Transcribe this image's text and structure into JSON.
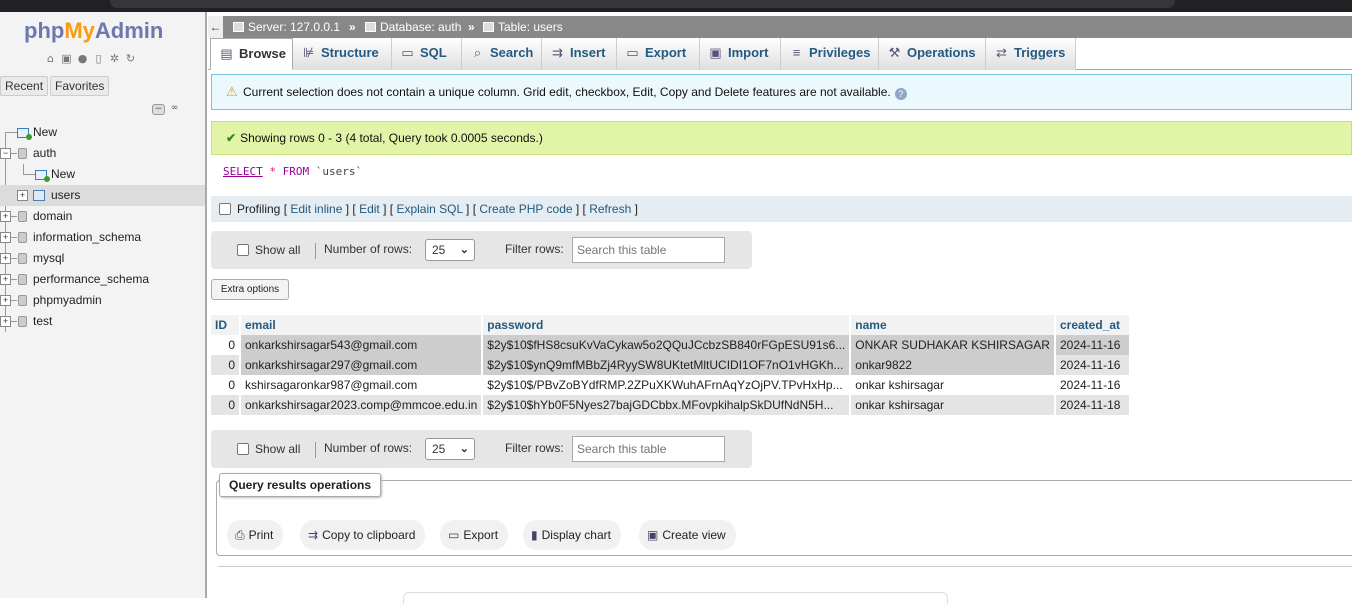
{
  "logo": {
    "part1": "php",
    "part2": "My",
    "part3": "Admin"
  },
  "left_tabs": {
    "recent": "Recent",
    "favorites": "Favorites"
  },
  "tree": {
    "new_root": "New",
    "auth": "auth",
    "auth_new": "New",
    "users": "users",
    "dbs": [
      "domain",
      "information_schema",
      "mysql",
      "performance_schema",
      "phpmyadmin",
      "test"
    ]
  },
  "breadcrumb": {
    "server": "Server: 127.0.0.1",
    "database": "Database: auth",
    "table": "Table: users",
    "sep": "»"
  },
  "tabs": [
    "Browse",
    "Structure",
    "SQL",
    "Search",
    "Insert",
    "Export",
    "Import",
    "Privileges",
    "Operations",
    "Triggers"
  ],
  "notice": "Current selection does not contain a unique column. Grid edit, checkbox, Edit, Copy and Delete features are not available.",
  "success": "Showing rows 0 - 3 (4 total, Query took 0.0005 seconds.)",
  "sql": {
    "select": "SELECT",
    "star": "*",
    "from": "FROM",
    "table": "`users`"
  },
  "profiling": {
    "label": "Profiling",
    "links": [
      "Edit inline",
      "Edit",
      "Explain SQL",
      "Create PHP code",
      "Refresh"
    ]
  },
  "nav": {
    "show_all": "Show all",
    "num_rows_label": "Number of rows:",
    "num_rows_value": "25",
    "filter_label": "Filter rows:",
    "filter_placeholder": "Search this table"
  },
  "extra_options": "Extra options",
  "table": {
    "columns": [
      "ID",
      "email",
      "password",
      "name",
      "created_at"
    ],
    "rows": [
      [
        "0",
        "onkarkshirsagar543@gmail.com",
        "$2y$10$fHS8csuKvVaCykaw5o2QQuJCcbzSB840rFGpESU91s6...",
        "ONKAR SUDHAKAR KSHIRSAGAR",
        "2024-11-16"
      ],
      [
        "0",
        "onkarkshirsagar297@gmail.com",
        "$2y$10$ynQ9mfMBbZj4RyySW8UKtetMltUCIDI1OF7nO1vHGKh...",
        "onkar9822",
        "2024-11-16"
      ],
      [
        "0",
        "kshirsagaronkar987@gmail.com",
        "$2y$10$/PBvZoBYdfRMP.2ZPuXKWuhAFrnAqYzOjPV.TPvHxHp...",
        "onkar kshirsagar",
        "2024-11-16"
      ],
      [
        "0",
        "onkarkshirsagar2023.comp@mmcoe.edu.in",
        "$2y$10$hYb0F5Nyes27bajGDCbbx.MFovpkihalpSkDUfNdN5H...",
        "onkar kshirsagar",
        "2024-11-18"
      ]
    ]
  },
  "query_ops": {
    "title": "Query results operations",
    "buttons": [
      "Print",
      "Copy to clipboard",
      "Export",
      "Display chart",
      "Create view"
    ]
  },
  "colors": {
    "link": "#235a81",
    "success_bg": "#e2f4a8",
    "notice_bg": "#ebf8fd",
    "breadcrumb_bg": "#888888"
  }
}
